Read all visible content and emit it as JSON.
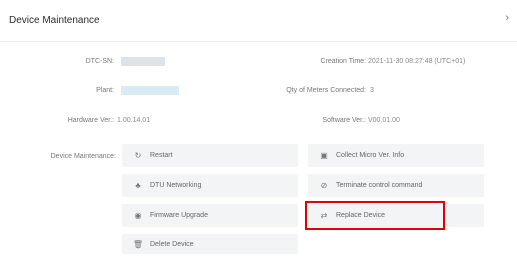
{
  "dialog": {
    "title": "Device Maintenance",
    "close_icon": "chevron-right-icon"
  },
  "info": {
    "dtc_sn_label": "DTC-SN:",
    "creation_time_label": "Creation Time:",
    "creation_time_value": "2021-11-30 08:27:48 (UTC+01)",
    "plant_label": "Plant:",
    "meters_connected_label": "Qty of Meters Connected:",
    "meters_connected_value": "3",
    "hardware_ver_label": "Hardware Ver.:",
    "hardware_ver_value": "1.00.14.01",
    "software_ver_label": "Software Ver.:",
    "software_ver_value": "V00.01.00"
  },
  "maintenance": {
    "label": "Device Maintenance:",
    "buttons": [
      {
        "label": "Restart",
        "icon": "restart-icon"
      },
      {
        "label": "Collect Micro Ver. Info",
        "icon": "info-icon"
      },
      {
        "label": "DTU Networking",
        "icon": "network-icon"
      },
      {
        "label": "Terminate control command",
        "icon": "stop-icon"
      },
      {
        "label": "Firmware Upgrade",
        "icon": "upgrade-icon"
      },
      {
        "label": "Replace Device",
        "icon": "swap-icon"
      },
      {
        "label": "Delete Device",
        "icon": "trash-icon"
      }
    ]
  }
}
